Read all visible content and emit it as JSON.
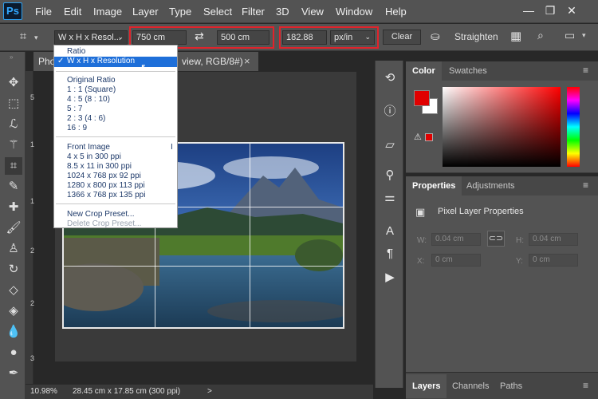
{
  "app": {
    "logo": "Ps"
  },
  "menu": [
    "File",
    "Edit",
    "Image",
    "Layer",
    "Type",
    "Select",
    "Filter",
    "3D",
    "View",
    "Window",
    "Help"
  ],
  "window_controls": {
    "minimize": "—",
    "restore": "❐",
    "close": "✕"
  },
  "options": {
    "crop_preset": "W x H x Resol...",
    "width_value": "750 cm",
    "height_value": "500 cm",
    "resolution_value": "182.88",
    "resolution_unit": "px/in",
    "clear_label": "Clear",
    "straighten_label": "Straighten",
    "swap_icon": "swap-icon"
  },
  "document_tab": {
    "title_prefix": "Pho",
    "title_suffix": "view, RGB/8#)",
    "close": "×"
  },
  "dropdown": {
    "items_group1": [
      "Ratio",
      "W x H x Resolution"
    ],
    "checked_item": "W x H x Resolution",
    "items_group2": [
      "Original Ratio",
      "1 : 1 (Square)",
      "4 : 5 (8 : 10)",
      "5 : 7",
      "2 : 3 (4 : 6)",
      "16 : 9"
    ],
    "items_group3": [
      "Front Image",
      "4 x 5 in 300 ppi",
      "8.5 x 11 in 300 ppi",
      "1024 x 768 px 92 ppi",
      "1280 x 800 px 113 ppi",
      "1366 x 768 px 135 ppi"
    ],
    "items_group4": [
      "New Crop Preset...",
      "Delete Crop Preset..."
    ],
    "shortcut": "I"
  },
  "ruler": {
    "numbers": [
      "5",
      "1",
      "1",
      "2",
      "2",
      "3"
    ]
  },
  "status": {
    "zoom": "10.98%",
    "doc_size": "28.45 cm x 17.85 cm (300 ppi)",
    "arrow": ">"
  },
  "color_panel": {
    "tabs": [
      "Color",
      "Swatches"
    ],
    "foreground": "#e00000",
    "background": "#ffffff"
  },
  "properties_panel": {
    "tabs": [
      "Properties",
      "Adjustments"
    ],
    "header": "Pixel Layer Properties",
    "w_label": "W:",
    "w_value": "0.04 cm",
    "h_label": "H:",
    "h_value": "0.04 cm",
    "x_label": "X:",
    "x_value": "0 cm",
    "y_label": "Y:",
    "y_value": "0 cm"
  },
  "layers_panel": {
    "tabs": [
      "Layers",
      "Channels",
      "Paths"
    ]
  },
  "colors": {
    "accent": "#e1232b",
    "selection": "#1e6fd9"
  }
}
